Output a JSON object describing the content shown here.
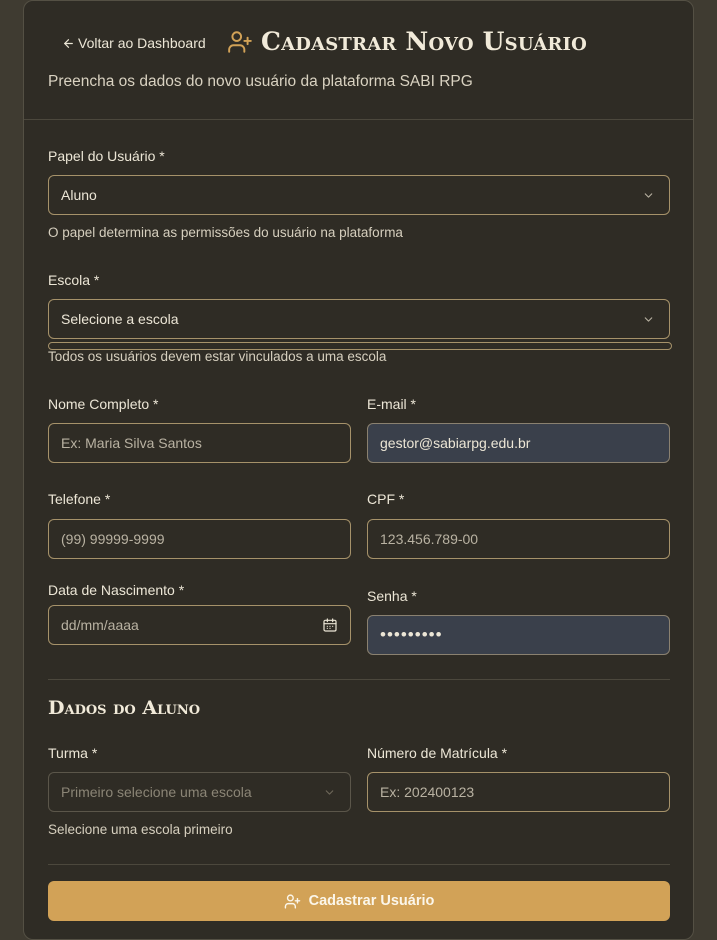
{
  "header": {
    "back_label": "Voltar ao Dashboard",
    "title": "Cadastrar Novo Usuário",
    "subtitle": "Preencha os dados do novo usuário da plataforma SABI RPG"
  },
  "form": {
    "role": {
      "label": "Papel do Usuário *",
      "value": "Aluno",
      "helper": "O papel determina as permissões do usuário na plataforma"
    },
    "school": {
      "label": "Escola *",
      "value": "Selecione a escola",
      "helper": "Todos os usuários devem estar vinculados a uma escola"
    },
    "name": {
      "label": "Nome Completo *",
      "placeholder": "Ex: Maria Silva Santos"
    },
    "email": {
      "label": "E-mail *",
      "value": "gestor@sabiarpg.edu.br"
    },
    "phone": {
      "label": "Telefone *",
      "placeholder": "(99) 99999-9999"
    },
    "cpf": {
      "label": "CPF *",
      "placeholder": "123.456.789-00"
    },
    "birth": {
      "label": "Data de Nascimento *",
      "placeholder": "dd/mm/aaaa"
    },
    "password": {
      "label": "Senha *",
      "value": "•••••••••"
    }
  },
  "student": {
    "section_title": "Dados do Aluno",
    "class": {
      "label": "Turma *",
      "value": "Primeiro selecione uma escola",
      "helper": "Selecione uma escola primeiro"
    },
    "enrollment": {
      "label": "Número de Matrícula *",
      "placeholder": "Ex: 202400123"
    }
  },
  "submit_label": "Cadastrar Usuário",
  "colors": {
    "accent": "#d2a257",
    "card": "#2f2c25",
    "background": "#3f3b31",
    "filled_input": "#3a404b",
    "border": "#a6926a"
  },
  "icons": {
    "back": "arrow-left-icon",
    "title": "user-plus-icon",
    "dropdown": "chevron-down-icon",
    "date": "calendar-icon",
    "submit": "user-plus-icon"
  }
}
